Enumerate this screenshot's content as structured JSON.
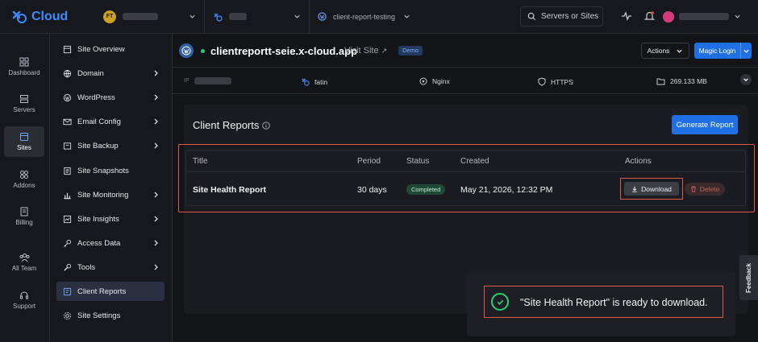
{
  "brand": {
    "name": "Cloud",
    "accent": "#1f6fe5"
  },
  "topbar": {
    "team_initials": "FT",
    "site_crumb": "client-report-testing",
    "search_placeholder": "Servers or Sites"
  },
  "rail": {
    "items": [
      {
        "label": "Dashboard",
        "icon": "grid-icon"
      },
      {
        "label": "Servers",
        "icon": "server-icon"
      },
      {
        "label": "Sites",
        "icon": "browser-icon",
        "active": true
      },
      {
        "label": "Addons",
        "icon": "addons-icon"
      },
      {
        "label": "Billing",
        "icon": "billing-icon"
      },
      {
        "label": "All Team",
        "icon": "team-icon"
      },
      {
        "label": "Support",
        "icon": "headset-icon"
      }
    ]
  },
  "sidebar": {
    "items": [
      {
        "label": "Site Overview",
        "chevron": false
      },
      {
        "label": "Domain",
        "chevron": true
      },
      {
        "label": "WordPress",
        "chevron": true
      },
      {
        "label": "Email Config",
        "chevron": true
      },
      {
        "label": "Site Backup",
        "chevron": true
      },
      {
        "label": "Site Snapshots",
        "chevron": false
      },
      {
        "label": "Site Monitoring",
        "chevron": true
      },
      {
        "label": "Site Insights",
        "chevron": true
      },
      {
        "label": "Access Data",
        "chevron": true
      },
      {
        "label": "Tools",
        "chevron": true
      },
      {
        "label": "Client Reports",
        "chevron": false,
        "active": true
      },
      {
        "label": "Site Settings",
        "chevron": false
      }
    ]
  },
  "site": {
    "name": "clientreportt-seie.x-cloud.app",
    "visit_label": "Visit Site",
    "badge": "Demo",
    "actions_label": "Actions",
    "magic_login_label": "Magic Login"
  },
  "info": {
    "ip_label": "IP",
    "user": "fatin",
    "server": "Nginx",
    "protocol": "HTTPS",
    "storage": "269.133 MB"
  },
  "reports": {
    "title": "Client Reports",
    "generate_label": "Generate Report",
    "columns": [
      "Title",
      "Period",
      "Status",
      "Created",
      "Actions"
    ],
    "rows": [
      {
        "title": "Site Health Report",
        "period": "30 days",
        "status": "Completed",
        "created": "May 21, 2026, 12:32 PM",
        "download_label": "Download",
        "delete_label": "Delete"
      }
    ]
  },
  "toast": {
    "message": "\"Site Health Report\" is ready to download."
  },
  "feedback_label": "Feedback"
}
